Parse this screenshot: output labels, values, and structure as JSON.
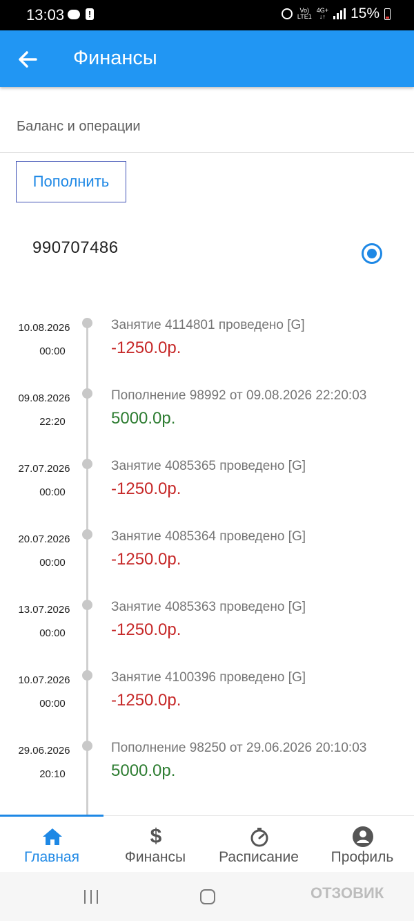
{
  "status_bar": {
    "time": "13:03",
    "network_top": "Vo)",
    "network_bottom": "LTE1",
    "net_type": "4G+",
    "battery": "15%"
  },
  "header": {
    "back_icon": "arrow-left-icon",
    "title": "Финансы"
  },
  "section": {
    "title": "Баланс и операции",
    "topup_label": "Пополнить"
  },
  "account": {
    "number": "990707486",
    "selected": true
  },
  "transactions": [
    {
      "date": "10.08.2026",
      "time": "00:00",
      "description": "Занятие 4114801 проведено [G]",
      "amount": "-1250.0р.",
      "type": "debit"
    },
    {
      "date": "09.08.2026",
      "time": "22:20",
      "description": "Пополнение 98992 от 09.08.2026 22:20:03",
      "amount": "5000.0р.",
      "type": "credit"
    },
    {
      "date": "27.07.2026",
      "time": "00:00",
      "description": "Занятие 4085365 проведено [G]",
      "amount": "-1250.0р.",
      "type": "debit"
    },
    {
      "date": "20.07.2026",
      "time": "00:00",
      "description": "Занятие 4085364 проведено [G]",
      "amount": "-1250.0р.",
      "type": "debit"
    },
    {
      "date": "13.07.2026",
      "time": "00:00",
      "description": "Занятие 4085363 проведено [G]",
      "amount": "-1250.0р.",
      "type": "debit"
    },
    {
      "date": "10.07.2026",
      "time": "00:00",
      "description": "Занятие 4100396 проведено [G]",
      "amount": "-1250.0р.",
      "type": "debit"
    },
    {
      "date": "29.06.2026",
      "time": "20:10",
      "description": "Пополнение 98250 от 29.06.2026 20:10:03",
      "amount": "5000.0р.",
      "type": "credit"
    }
  ],
  "bottom_nav": {
    "items": [
      {
        "label": "Главная",
        "icon": "home-icon",
        "active": true
      },
      {
        "label": "Финансы",
        "icon": "dollar-icon",
        "active": false
      },
      {
        "label": "Расписание",
        "icon": "stopwatch-icon",
        "active": false
      },
      {
        "label": "Профиль",
        "icon": "user-icon",
        "active": false
      }
    ]
  },
  "watermark": "ОТЗОВИК",
  "colors": {
    "accent": "#2196f3",
    "debit": "#c62828",
    "credit": "#2e7d32",
    "active_nav": "#1e88e5"
  }
}
